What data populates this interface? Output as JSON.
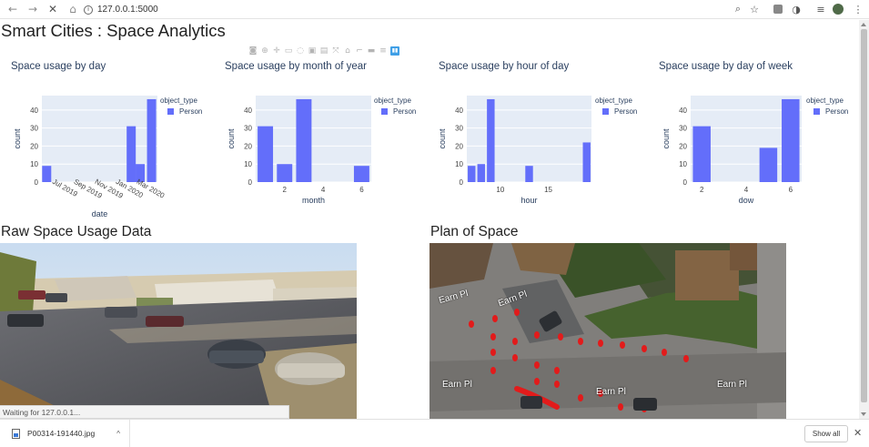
{
  "browser": {
    "url": "127.0.0.1:5000"
  },
  "app": {
    "title": "Smart Cities : Space Analytics"
  },
  "charts": [
    {
      "title": "Space usage by day",
      "legend_title": "object_type",
      "legend_item": "Person",
      "xlabel": "date",
      "ylabel": "count",
      "xticks": [
        "Jul 2019",
        "Sep 2019",
        "Nov 2019",
        "Jan 2020",
        "Mar 2020"
      ],
      "yticks": [
        "0",
        "10",
        "20",
        "30",
        "40"
      ]
    },
    {
      "title": "Space usage by month of year",
      "legend_title": "object_type",
      "legend_item": "Person",
      "xlabel": "month",
      "ylabel": "count",
      "xticks": [
        "2",
        "4",
        "6"
      ],
      "yticks": [
        "0",
        "10",
        "20",
        "30",
        "40"
      ]
    },
    {
      "title": "Space usage by hour of day",
      "legend_title": "object_type",
      "legend_item": "Person",
      "xlabel": "hour",
      "ylabel": "count",
      "xticks": [
        "10",
        "15"
      ],
      "yticks": [
        "0",
        "10",
        "20",
        "30",
        "40"
      ]
    },
    {
      "title": "Space usage by day of week",
      "legend_title": "object_type",
      "legend_item": "Person",
      "xlabel": "dow",
      "ylabel": "count",
      "xticks": [
        "2",
        "4",
        "6"
      ],
      "yticks": [
        "0",
        "10",
        "20",
        "30",
        "40"
      ]
    }
  ],
  "chart_data": [
    {
      "type": "bar",
      "title": "Space usage by day",
      "xlabel": "date",
      "ylabel": "count",
      "x": [
        "2019-05-15",
        "2020-01-15",
        "2020-02-10",
        "2020-03-14"
      ],
      "series": [
        {
          "name": "Person",
          "values": [
            9,
            31,
            10,
            46
          ]
        }
      ],
      "xlim": [
        "2019-05-01",
        "2020-03-31"
      ],
      "ylim": [
        0,
        48
      ],
      "legend": "top-right",
      "color": "#636efa"
    },
    {
      "type": "bar",
      "title": "Space usage by month of year",
      "xlabel": "month",
      "ylabel": "count",
      "x": [
        1,
        2,
        3,
        6
      ],
      "series": [
        {
          "name": "Person",
          "values": [
            31,
            10,
            46,
            9
          ]
        }
      ],
      "xlim": [
        0.5,
        6.5
      ],
      "ylim": [
        0,
        48
      ],
      "legend": "top-right",
      "color": "#636efa"
    },
    {
      "type": "bar",
      "title": "Space usage by hour of day",
      "xlabel": "hour",
      "ylabel": "count",
      "x": [
        7,
        8,
        9,
        13,
        19
      ],
      "series": [
        {
          "name": "Person",
          "values": [
            9,
            10,
            46,
            9,
            22
          ]
        }
      ],
      "xlim": [
        6.5,
        19.5
      ],
      "ylim": [
        0,
        48
      ],
      "legend": "top-right",
      "color": "#636efa"
    },
    {
      "type": "bar",
      "title": "Space usage by day of week",
      "xlabel": "dow",
      "ylabel": "count",
      "x": [
        2,
        5,
        6
      ],
      "series": [
        {
          "name": "Person",
          "values": [
            31,
            19,
            46
          ]
        }
      ],
      "xlim": [
        1.5,
        6.5
      ],
      "ylim": [
        0,
        48
      ],
      "legend": "top-right",
      "color": "#636efa"
    }
  ],
  "sections": {
    "raw": "Raw Space Usage Data",
    "plan": "Plan of Space"
  },
  "plan_labels": [
    "Earn Pl",
    "Earn Pl",
    "Earn Pl",
    "Earn Pl",
    "Earn Pl"
  ],
  "status": "Waiting for 127.0.0.1...",
  "downloads": {
    "file": "P00314-191440.jpg",
    "show_all": "Show all"
  }
}
